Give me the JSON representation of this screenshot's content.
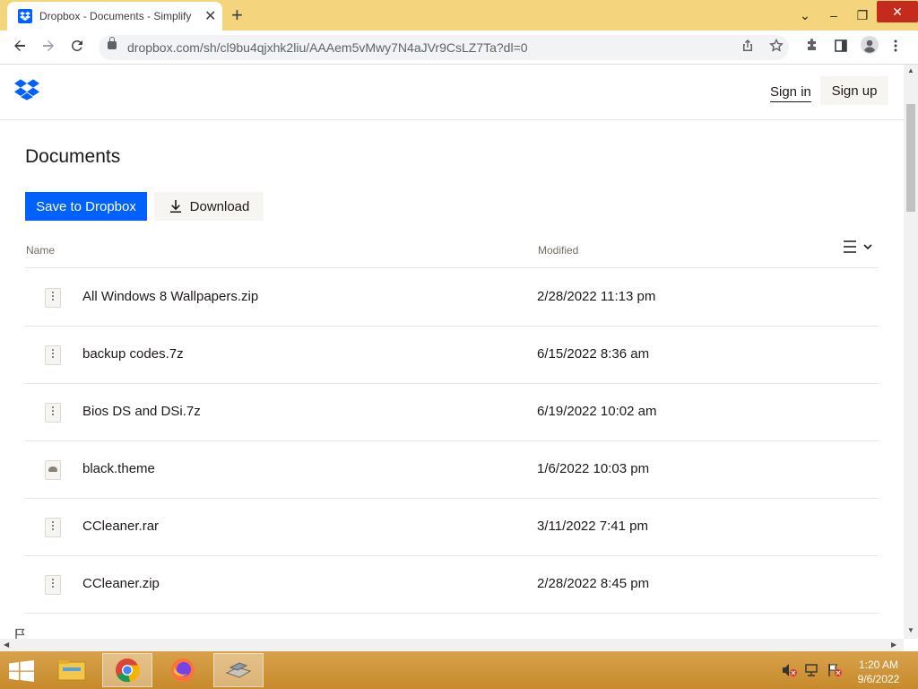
{
  "browser": {
    "tab_title": "Dropbox - Documents - Simplify",
    "tab_close": "✕",
    "new_tab": "+",
    "url": "dropbox.com/sh/cl9bu4qjxhk2liu/AAAem5vMwy7N4aJVr9CsLZ7Ta?dl=0",
    "window_controls": {
      "dropdown": "⌄",
      "minimize": "–",
      "restore": "❐",
      "close": "✕"
    },
    "icons": [
      "back-icon",
      "forward-icon",
      "reload-icon",
      "lock-icon",
      "share-icon",
      "star-icon",
      "extensions-icon",
      "sidepanel-icon",
      "profile-icon",
      "menu-icon"
    ]
  },
  "header": {
    "sign_in": "Sign in",
    "sign_up": "Sign up"
  },
  "main": {
    "title": "Documents",
    "save_button": "Save to Dropbox",
    "download_button": "Download",
    "columns": {
      "name": "Name",
      "modified": "Modified"
    }
  },
  "files": [
    {
      "name": "All Windows 8 Wallpapers.zip",
      "modified": "2/28/2022 11:13 pm",
      "icon": "zip-file-icon"
    },
    {
      "name": "backup codes.7z",
      "modified": "6/15/2022 8:36 am",
      "icon": "zip-file-icon"
    },
    {
      "name": "Bios DS and DSi.7z",
      "modified": "6/19/2022 10:02 am",
      "icon": "zip-file-icon"
    },
    {
      "name": "black.theme",
      "modified": "1/6/2022 10:03 pm",
      "icon": "theme-file-icon"
    },
    {
      "name": "CCleaner.rar",
      "modified": "3/11/2022 7:41 pm",
      "icon": "zip-file-icon"
    },
    {
      "name": "CCleaner.zip",
      "modified": "2/28/2022 8:45 pm",
      "icon": "zip-file-icon"
    }
  ],
  "taskbar": {
    "apps": [
      "file-explorer-icon",
      "chrome-icon",
      "firefox-icon",
      "app-icon"
    ],
    "clock_time": "1:20 AM",
    "clock_date": "9/6/2022"
  },
  "colors": {
    "accent": "#0061fe",
    "tabstrip": "#f4d57d",
    "taskbar": "#d8a24b"
  }
}
